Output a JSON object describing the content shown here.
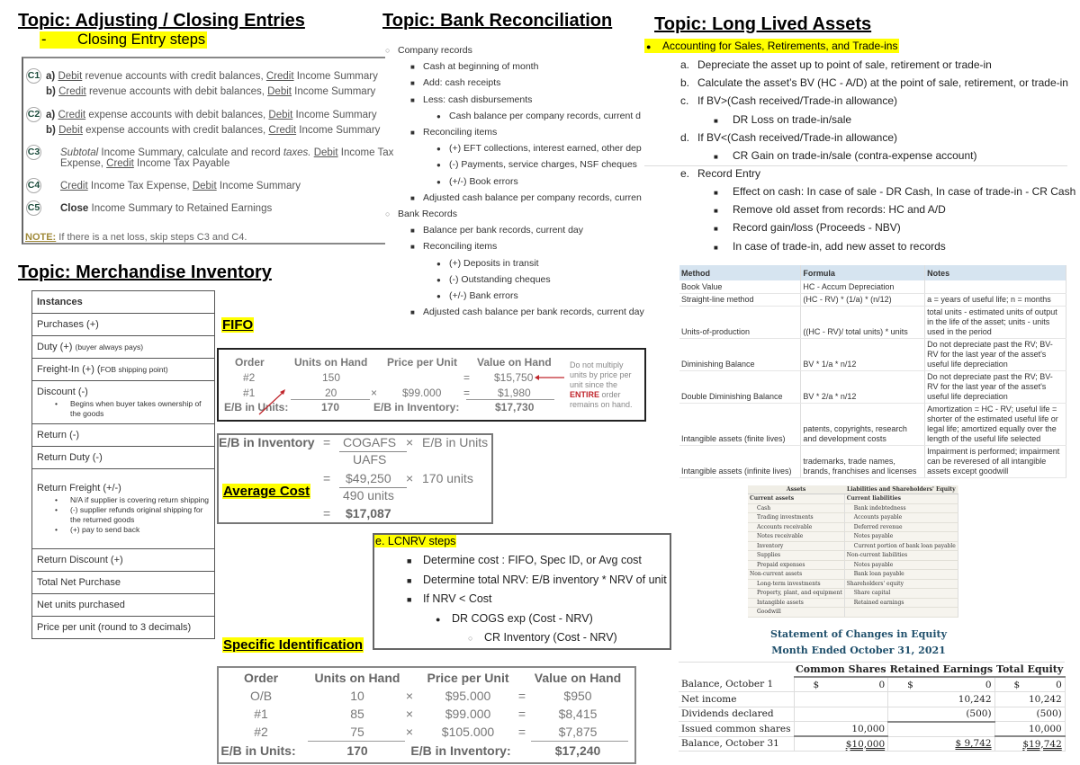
{
  "closing": {
    "topic": "Topic: Adjusting / Closing Entries",
    "subtitle_marker": "-",
    "subtitle": "Closing Entry steps",
    "steps": [
      {
        "badge": "C1",
        "lines": [
          {
            "label": "a)",
            "w1": "Debit",
            "t1": " revenue accounts with credit balances, ",
            "w2": "Credit",
            "t2": " Income Summary"
          },
          {
            "label": "b)",
            "w1": "Credit",
            "t1": " revenue accounts with debit balances, ",
            "w2": "Debit",
            "t2": " Income Summary"
          }
        ]
      },
      {
        "badge": "C2",
        "lines": [
          {
            "label": "a)",
            "w1": "Credit",
            "t1": " expense accounts with debit balances, ",
            "w2": "Debit",
            "t2": " Income Summary"
          },
          {
            "label": "b)",
            "w1": "Debit",
            "t1": " expense accounts with credit balances, ",
            "w2": "Credit",
            "t2": " Income Summary"
          }
        ]
      },
      {
        "badge": "C3",
        "italic1": "Subtotal",
        "t1": " Income Summary, calculate and record ",
        "italic2": "taxes.",
        "t2": " ",
        "w1": "Debit",
        "t3": " Income Tax",
        "line2_t1": "Expense, ",
        "w2": "Credit",
        "line2_t2": " Income Tax Payable"
      },
      {
        "badge": "C4",
        "w1": "Credit",
        "t1": " Income Tax Expense, ",
        "w2": "Debit",
        "t2": " Income Summary"
      },
      {
        "badge": "C5",
        "bold": "Close",
        "t1": " Income Summary to Retained Earnings"
      }
    ],
    "note_label": "NOTE:",
    "note_text": " If there is a net loss, skip steps C3 and C4."
  },
  "bank": {
    "topic": "Topic: Bank Reconciliation",
    "lines": [
      {
        "level": 1,
        "marker": "○",
        "text": "Company records"
      },
      {
        "level": 2,
        "marker": "■",
        "text": "Cash at beginning of month"
      },
      {
        "level": 2,
        "marker": "■",
        "text": "Add: cash receipts"
      },
      {
        "level": 2,
        "marker": "■",
        "text": "Less: cash disbursements"
      },
      {
        "level": 3,
        "marker": "●",
        "text": "Cash balance per company records, current d"
      },
      {
        "level": 2,
        "marker": "■",
        "text": "Reconciling items"
      },
      {
        "level": 3,
        "marker": "●",
        "text": "(+) EFT collections, interest earned, other dep"
      },
      {
        "level": 3,
        "marker": "●",
        "text": "(-) Payments, service charges, NSF cheques"
      },
      {
        "level": 3,
        "marker": "●",
        "text": "(+/-) Book errors"
      },
      {
        "level": 2,
        "marker": "■",
        "text": "Adjusted cash balance per company records, curren"
      },
      {
        "level": 1,
        "marker": "○",
        "text": "Bank Records"
      },
      {
        "level": 2,
        "marker": "■",
        "text": "Balance per bank records, current day"
      },
      {
        "level": 2,
        "marker": "■",
        "text": "Reconciling items"
      },
      {
        "level": 3,
        "marker": "●",
        "text": "(+) Deposits in transit"
      },
      {
        "level": 3,
        "marker": "●",
        "text": "(-) Outstanding cheques"
      },
      {
        "level": 3,
        "marker": "●",
        "text": "(+/-) Bank errors"
      },
      {
        "level": 2,
        "marker": "■",
        "text": "Adjusted cash balance per bank records, current day"
      }
    ]
  },
  "lla": {
    "topic": "Topic: Long Lived Assets",
    "subtitle_marker": "●",
    "subtitle": "Accounting for Sales, Retirements, and Trade-ins",
    "lines": [
      {
        "level": 1,
        "marker": "a.",
        "text": "Depreciate the asset up to point of sale, retirement or trade-in"
      },
      {
        "level": 1,
        "marker": "b.",
        "text": "Calculate the asset’s BV (HC - A/D) at the point of sale, retirement, or trade-in"
      },
      {
        "level": 1,
        "marker": "c.",
        "text": "If BV>(Cash received/Trade-in allowance)"
      },
      {
        "level": 2,
        "marker": "■",
        "text": "DR Loss on trade-in/sale"
      },
      {
        "level": 1,
        "marker": "d.",
        "text": "If BV<(Cash received/Trade-in allowance)"
      },
      {
        "level": 2,
        "marker": "■",
        "text": "CR Gain on trade-in/sale (contra-expense account)"
      },
      {
        "level": 1,
        "marker": "e.",
        "text": "Record Entry"
      },
      {
        "level": 2,
        "marker": "■",
        "text": "Effect on cash: In case of sale - DR Cash, In case of trade-in - CR Cash"
      },
      {
        "level": 2,
        "marker": "■",
        "text": "Remove old asset from records: HC and A/D"
      },
      {
        "level": 2,
        "marker": "■",
        "text": "Record gain/loss (Proceeds - NBV)"
      },
      {
        "level": 2,
        "marker": "■",
        "text": "In case of trade-in, add new asset to records"
      }
    ]
  },
  "depreciation_table": {
    "headers": [
      "Method",
      "Formula",
      "Notes"
    ],
    "rows": [
      [
        "Book Value",
        "HC - Accum Depreciation",
        ""
      ],
      [
        "Straight-line method",
        "(HC - RV) * (1/a) * (n/12)",
        "a = years of useful life; n = months"
      ],
      [
        "Units-of-production",
        "((HC - RV)/ total units) * units",
        "total units - estimated units of output in the life of the asset; units - units used in the period"
      ],
      [
        "Diminishing Balance",
        "BV * 1/a * n/12",
        "Do not depreciate past the RV; BV-RV for the last year of the asset's useful life depreciation"
      ],
      [
        "Double Diminishing Balance",
        "BV * 2/a * n/12",
        "Do not depreciate past the RV; BV-RV for the last year of the asset's useful life depreciation"
      ],
      [
        "Intangible assets (finite lives)",
        "patents, copyrights, research and development costs",
        "Amortization = HC - RV; useful life = shorter of the estimated useful life or legal life; amortized equally over the length of the useful life selected"
      ],
      [
        "Intangible assets (infinite lives)",
        "trademarks, trade names, brands, franchises and licenses",
        "Impairment is performed; impairment can be reveresed of all intangible assets except goodwill"
      ]
    ]
  },
  "balance_sheet": {
    "headers": [
      "Assets",
      "Liabilities and Shareholders' Equity"
    ],
    "rows": [
      [
        {
          "t": "Current assets",
          "s": "hd"
        },
        {
          "t": "Current liabilities",
          "s": "hd"
        }
      ],
      [
        {
          "t": "Cash",
          "s": "ind"
        },
        {
          "t": "Bank indebtedness",
          "s": "ind"
        }
      ],
      [
        {
          "t": "Trading investments",
          "s": "ind"
        },
        {
          "t": "Accounts payable",
          "s": "ind"
        }
      ],
      [
        {
          "t": "Accounts receivable",
          "s": "ind"
        },
        {
          "t": "Deferred revenue",
          "s": "ind"
        }
      ],
      [
        {
          "t": "Notes receivable",
          "s": "ind"
        },
        {
          "t": "Notes payable",
          "s": "ind"
        }
      ],
      [
        {
          "t": "Inventory",
          "s": "ind"
        },
        {
          "t": "Current portion of bank loan payable",
          "s": "ind"
        }
      ],
      [
        {
          "t": "Supplies",
          "s": "ind"
        },
        {
          "t": "Non-current liabilities",
          "s": ""
        }
      ],
      [
        {
          "t": "Prepaid expenses",
          "s": "ind"
        },
        {
          "t": "Notes payable",
          "s": "ind"
        }
      ],
      [
        {
          "t": "Non-current assets",
          "s": ""
        },
        {
          "t": "Bank loan payable",
          "s": "ind"
        }
      ],
      [
        {
          "t": "Long-term investments",
          "s": "ind"
        },
        {
          "t": "Shareholders' equity",
          "s": ""
        }
      ],
      [
        {
          "t": "Property, plant, and equipment",
          "s": "ind"
        },
        {
          "t": "Share capital",
          "s": "ind"
        }
      ],
      [
        {
          "t": "Intangible assets",
          "s": "ind"
        },
        {
          "t": "Retained earnings",
          "s": "ind"
        }
      ],
      [
        {
          "t": "Goodwill",
          "s": "ind"
        },
        {
          "t": "",
          "s": ""
        }
      ]
    ]
  },
  "equity_statement": {
    "title": "Statement of Changes in Equity",
    "period": "Month Ended October 31, 2021",
    "headers": [
      "",
      "Common Shares",
      "Retained Earnings",
      "Total Equity"
    ],
    "rows": [
      {
        "label": "Balance, October 1",
        "cs": "0",
        "re": "0",
        "te": "0",
        "dollar": true
      },
      {
        "label": "Net income",
        "cs": "",
        "re": "10,242",
        "te": "10,242"
      },
      {
        "label": "Dividends declared",
        "cs": "",
        "re": "(500)",
        "te": "(500)"
      },
      {
        "label": "Issued common shares",
        "cs": "10,000",
        "re": "",
        "te": "10,000"
      },
      {
        "label": "Balance, October 31",
        "cs": "$10,000",
        "re": "$ 9,742",
        "te": "$19,742",
        "total": true
      }
    ],
    "dollar_sign": "$"
  },
  "merch": {
    "topic": "Topic: Merchandise Inventory",
    "rows": [
      {
        "text": "Instances",
        "header": true
      },
      {
        "text": "Purchases (+)"
      },
      {
        "text": "Duty (+) ",
        "small": "(buyer always pays)"
      },
      {
        "text": "Freight-In (+) (",
        "small": "FOB shipping point)"
      },
      {
        "text": "Discount (-)",
        "bullets": [
          "Begins when buyer takes ownership of the goods"
        ]
      },
      {
        "text": "Return (-)"
      },
      {
        "text": "Return Duty (-)"
      },
      {
        "text": "Return Freight (+/-)",
        "bullets": [
          "N/A  if supplier is covering return shipping",
          "(-) supplier refunds original shipping for the returned goods",
          "(+) pay to send back"
        ]
      },
      {
        "text": "Return Discount (+)"
      },
      {
        "text": "Total Net Purchase"
      },
      {
        "text": "Net units purchased"
      },
      {
        "text": "Price per unit (round to 3 decimals)"
      }
    ]
  },
  "fifo": {
    "label": "FIFO",
    "headers": [
      "Order",
      "Units on Hand",
      "Price per Unit",
      "Value on Hand"
    ],
    "rows": [
      {
        "order": "#2",
        "units": "150",
        "times": "",
        "price": "",
        "eq": "=",
        "value": "$15,750"
      },
      {
        "order": "#1",
        "units": "20",
        "times": "×",
        "price": "$99.000",
        "eq": "=",
        "value": "$1,980"
      }
    ],
    "total_units_label": "E/B in Units:",
    "total_units": "170",
    "total_inv_label": "E/B in Inventory:",
    "total_value": "$17,730",
    "note_pre": "Do not multiply units by price per unit since the ",
    "note_em": "ENTIRE",
    "note_post": " order remains on hand.",
    "note_color": "#c0262c"
  },
  "average": {
    "label": "Average Cost",
    "lhs": "E/B in Inventory",
    "eq": "=",
    "num1": "COGAFS",
    "den1": "UAFS",
    "times": "×",
    "mul1": "E/B in Units",
    "num2": "$49,250",
    "den2": "490 units",
    "mul2": "170 units",
    "result": "$17,087"
  },
  "lcnrv": {
    "title": "e.  LCNRV steps",
    "lines": [
      {
        "level": 1,
        "marker": "■",
        "text": "Determine cost : FIFO, Spec ID, or Avg cost"
      },
      {
        "level": 1,
        "marker": "■",
        "text": "Determine total NRV: E/B inventory * NRV of unit"
      },
      {
        "level": 1,
        "marker": "■",
        "text": "If NRV < Cost"
      },
      {
        "level": 2,
        "marker": "●",
        "text": "DR COGS exp (Cost - NRV)"
      },
      {
        "level": 3,
        "marker": "○",
        "text": "CR Inventory (Cost - NRV)"
      }
    ]
  },
  "specific": {
    "label": "Specific Identification",
    "headers": [
      "Order",
      "Units on Hand",
      "Price per Unit",
      "Value on Hand"
    ],
    "rows": [
      {
        "order": "O/B",
        "units": "10",
        "times": "×",
        "price": "$95.000",
        "eq": "=",
        "value": "$950"
      },
      {
        "order": "#1",
        "units": "85",
        "times": "×",
        "price": "$99.000",
        "eq": "=",
        "value": "$8,415"
      },
      {
        "order": "#2",
        "units": "75",
        "times": "×",
        "price": "$105.000",
        "eq": "=",
        "value": "$7,875"
      }
    ],
    "total_units_label": "E/B in Units:",
    "total_units": "170",
    "total_inv_label": "E/B in Inventory:",
    "total_value": "$17,240"
  },
  "colors": {
    "highlight": "#ffff00",
    "accent_red": "#c0262c",
    "table_header_blue": "#d6e4f0",
    "equity_title": "#1f4f6b",
    "badge_green": "#1a4a3a"
  }
}
